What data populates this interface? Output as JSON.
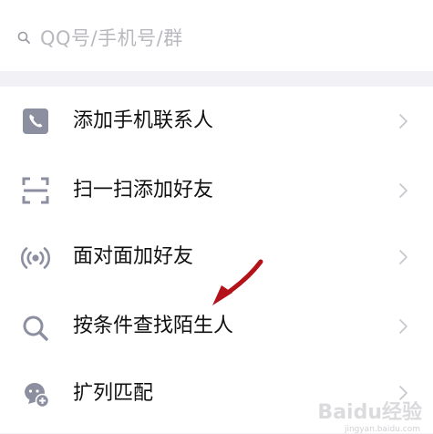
{
  "search": {
    "placeholder": "QQ号/手机号/群"
  },
  "menu": {
    "items": [
      {
        "label": "添加手机联系人",
        "icon": "phone-icon"
      },
      {
        "label": "扫一扫添加好友",
        "icon": "scan-icon"
      },
      {
        "label": "面对面加好友",
        "icon": "face-to-face-signal-icon"
      },
      {
        "label": "按条件查找陌生人",
        "icon": "search-icon"
      },
      {
        "label": "扩列匹配",
        "icon": "match-bubble-icon"
      }
    ]
  },
  "annotation": {
    "arrow_color": "#b3121a"
  },
  "watermark": {
    "text": "Baidu经验",
    "sub": "jingyan.baidu.com"
  },
  "colors": {
    "icon_gray": "#8b8fa0",
    "text": "#111111",
    "placeholder": "#b8b8bf",
    "background": "#f2f2f6",
    "chevron": "#c5c5cc"
  }
}
